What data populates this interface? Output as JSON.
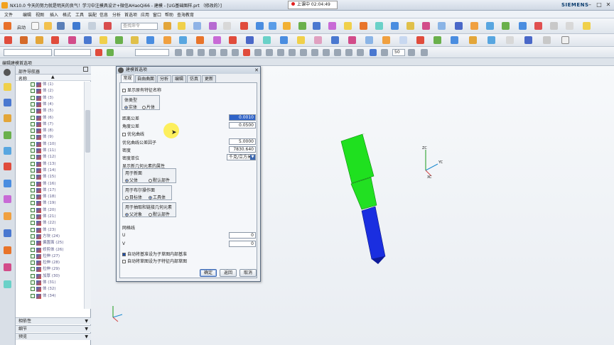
{
  "window": {
    "title": "NX10.0 今天的努力就是明天的良气！学习中注模具设计+微信AHaoQi66 - 建模 - [UG基础图样.prt （修改的）]",
    "brand": "SIEMENS"
  },
  "recording": {
    "label": "上课中 02:04:49"
  },
  "menu": [
    "文件",
    "编辑",
    "视图",
    "插入",
    "格式",
    "工具",
    "装配",
    "信息",
    "分析",
    "首选项",
    "应用",
    "窗口",
    "帮助",
    "查海教育"
  ],
  "toolbar": {
    "start_label": "启动",
    "search_placeholder": "查找命令",
    "zoom": "50"
  },
  "workspace_label": "编辑建模首选项",
  "navigator": {
    "title": "部件导航器",
    "col_name": "名称",
    "items": [
      "体 (1)",
      "体 (2)",
      "体 (3)",
      "体 (4)",
      "体 (5)",
      "体 (6)",
      "体 (7)",
      "体 (8)",
      "体 (9)",
      "体 (10)",
      "体 (11)",
      "体 (12)",
      "体 (13)",
      "体 (14)",
      "体 (15)",
      "体 (16)",
      "体 (17)",
      "体 (18)",
      "体 (19)",
      "体 (20)",
      "体 (21)",
      "体 (22)",
      "体 (23)",
      "方块 (24)",
      "偏置面 (25)",
      "修剪体 (26)",
      "拉伸 (27)",
      "拉伸 (28)",
      "拉伸 (29)",
      "加厚 (30)",
      "体 (31)",
      "体 (32)",
      "体 (34)"
    ],
    "sections": [
      "相依性",
      "细节",
      "预览"
    ]
  },
  "dialog": {
    "title": "建模首选项",
    "tabs": [
      "常规",
      "自由曲面",
      "分析",
      "编辑",
      "仿真",
      "更新"
    ],
    "show_feature_names": "显示原有特征名称",
    "body_type_group": "体类型",
    "body_solid": "实体",
    "body_sheet": "片体",
    "dist_tol_label": "距离公差",
    "dist_tol": "0.0010",
    "angle_tol_label": "角度公差",
    "angle_tol": "0.0500",
    "optimize_curve": "优化曲线",
    "opt_factor_label": "优化曲线公差因子",
    "opt_factor": "5.0000",
    "density_label": "密度",
    "density": "7830.640",
    "density_unit_label": "密度单位",
    "density_unit": "千克/立方米",
    "new_body_props": "显示新几何元素的属性",
    "new_face_group": "用于新面",
    "new_face_parent": "父体",
    "new_face_default": "默认部件",
    "boolean_group": "用于布尔操作面",
    "bool_target": "目标体",
    "bool_tool": "工具体",
    "extract_group": "用于抽取和链接几何元素",
    "extract_parent": "父对象",
    "extract_default": "默认部件",
    "grid_label": "网格线",
    "u_label": "U",
    "u_val": "0",
    "v_label": "V",
    "v_val": "0",
    "auto_datum": "自动将基准设为子草图内部基准",
    "auto_sketch": "自动将草图设为子特征内部草图",
    "ok": "确定",
    "apply": "返回",
    "cancel": "取消"
  },
  "triad": {
    "zc": "ZC",
    "yc": "YC",
    "xc": "XC"
  },
  "colors": {
    "green": "#1fe01f",
    "blue": "#1a2ee0",
    "brand": "#0a3c6e"
  }
}
